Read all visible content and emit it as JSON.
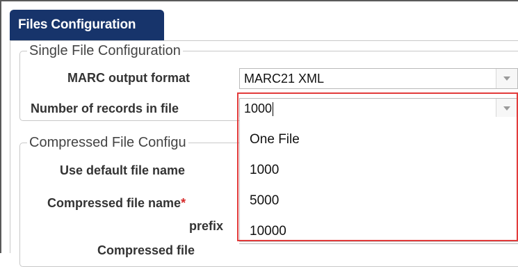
{
  "panel": {
    "title": "Files Configuration"
  },
  "single_file": {
    "legend": "Single File Configuration",
    "marc_format": {
      "label": "MARC output format",
      "value": "MARC21 XML"
    },
    "records_in_file": {
      "label": "Number of records in file",
      "value": "1000",
      "options": [
        "One File",
        "1000",
        "5000",
        "10000"
      ]
    }
  },
  "compressed_file": {
    "legend": "Compressed File Configu",
    "default_name": {
      "label": "Use default file name"
    },
    "name_prefix": {
      "label_line1": "Compressed file name",
      "required_mark": "*",
      "label_line2": "prefix"
    },
    "compressed_next": {
      "label": "Compressed file"
    }
  },
  "icons": {
    "combo_arrow": "chevron-down-icon"
  },
  "colors": {
    "tab_bg": "#17346b",
    "highlight_border": "#e23b3b",
    "required": "#d62a2a"
  }
}
